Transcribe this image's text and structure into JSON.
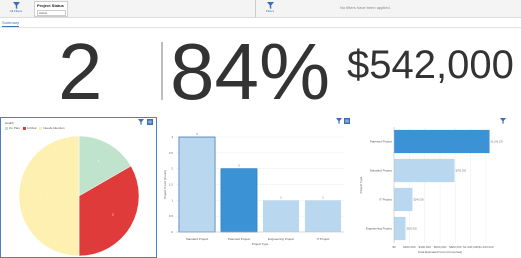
{
  "topbar": {
    "filter_button_label": "All Filters",
    "project_status_label": "Project Status",
    "project_status_value": "Active",
    "filters_label": "Filters",
    "no_filters_text": "No filters have been applied."
  },
  "tabs": [
    {
      "label": "Summary"
    }
  ],
  "kpis": {
    "count": "2",
    "percent": "84%",
    "amount": "$542,000"
  },
  "colors": {
    "accent": "#3a6fb5",
    "on_plan": "#bfe3cc",
    "at_risk": "#e03b3b",
    "needs_attention": "#fdf0b0",
    "bar": "#b9d8f0",
    "bar_highlight": "#3b93d6"
  },
  "chart_data": [
    {
      "type": "pie",
      "legend_title": "Health",
      "legend": [
        "On Plan",
        "At Risk",
        "Needs Attention"
      ],
      "values": [
        1,
        2,
        3
      ],
      "labels": [
        "1",
        "2",
        "3"
      ],
      "legend_position": "top-left"
    },
    {
      "type": "bar",
      "categories": [
        "Standard Project",
        "Patented Project",
        "Engineering Project",
        "IT Project"
      ],
      "values": [
        3,
        2,
        1,
        1
      ],
      "xlabel": "Project Type",
      "ylabel": "Project Count (Count)",
      "ylim": [
        0,
        3
      ],
      "yticks": [
        "0",
        "0.5",
        "1",
        "1.5",
        "2",
        "2.5",
        "3"
      ],
      "data_labels": [
        "3",
        "2",
        "1",
        "1"
      ],
      "highlight_index": 1
    },
    {
      "type": "bar",
      "orientation": "horizontal",
      "categories": [
        "Patented Project",
        "Standard Project",
        "IT Project",
        "Engineering Project"
      ],
      "values": [
        1246000,
        790000,
        240000,
        150000
      ],
      "data_labels": [
        "$1,246,220",
        "$790,000",
        "$240,000",
        "$150,000"
      ],
      "xlabel": "Total Estimated Cost (Converted)",
      "ylabel": "Project Type",
      "xlim": [
        0,
        1200000
      ],
      "xticks": [
        "$0",
        "$200,000",
        "$400,000",
        "$600,000",
        "$800,000",
        "$1,000,000",
        "$1,200,000"
      ],
      "highlight_index": 0
    }
  ]
}
